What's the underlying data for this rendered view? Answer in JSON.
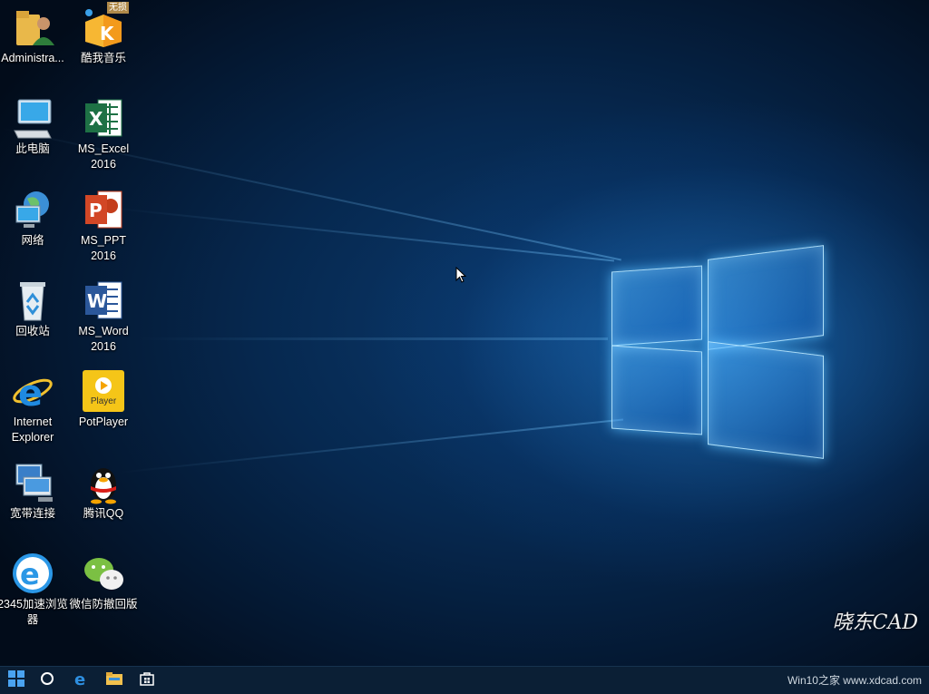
{
  "desktop_icons": [
    {
      "label": "Administra..."
    },
    {
      "label": "酷我音乐",
      "badge": "无损"
    },
    {
      "label": "此电脑"
    },
    {
      "label": "MS_Excel 2016"
    },
    {
      "label": "网络"
    },
    {
      "label": "MS_PPT 2016"
    },
    {
      "label": "回收站"
    },
    {
      "label": "MS_Word 2016"
    },
    {
      "label": "Internet Explorer"
    },
    {
      "label": "PotPlayer",
      "glyph_text": "Player"
    },
    {
      "label": "宽带连接"
    },
    {
      "label": "腾讯QQ"
    },
    {
      "label": "2345加速浏览器"
    },
    {
      "label": "微信防撤回版"
    }
  ],
  "watermark": {
    "logo_text": "晓东CAD",
    "site_text": "Win10之家 www.xdcad.com"
  },
  "taskbar": {
    "items": [
      "start-icon",
      "cortana-search-icon",
      "edge-icon",
      "file-explorer-icon",
      "store-icon"
    ]
  },
  "colors": {
    "desktop_bg": "#06284f",
    "taskbar": "#0b1f35",
    "logo_glow": "#5ab4ff"
  }
}
